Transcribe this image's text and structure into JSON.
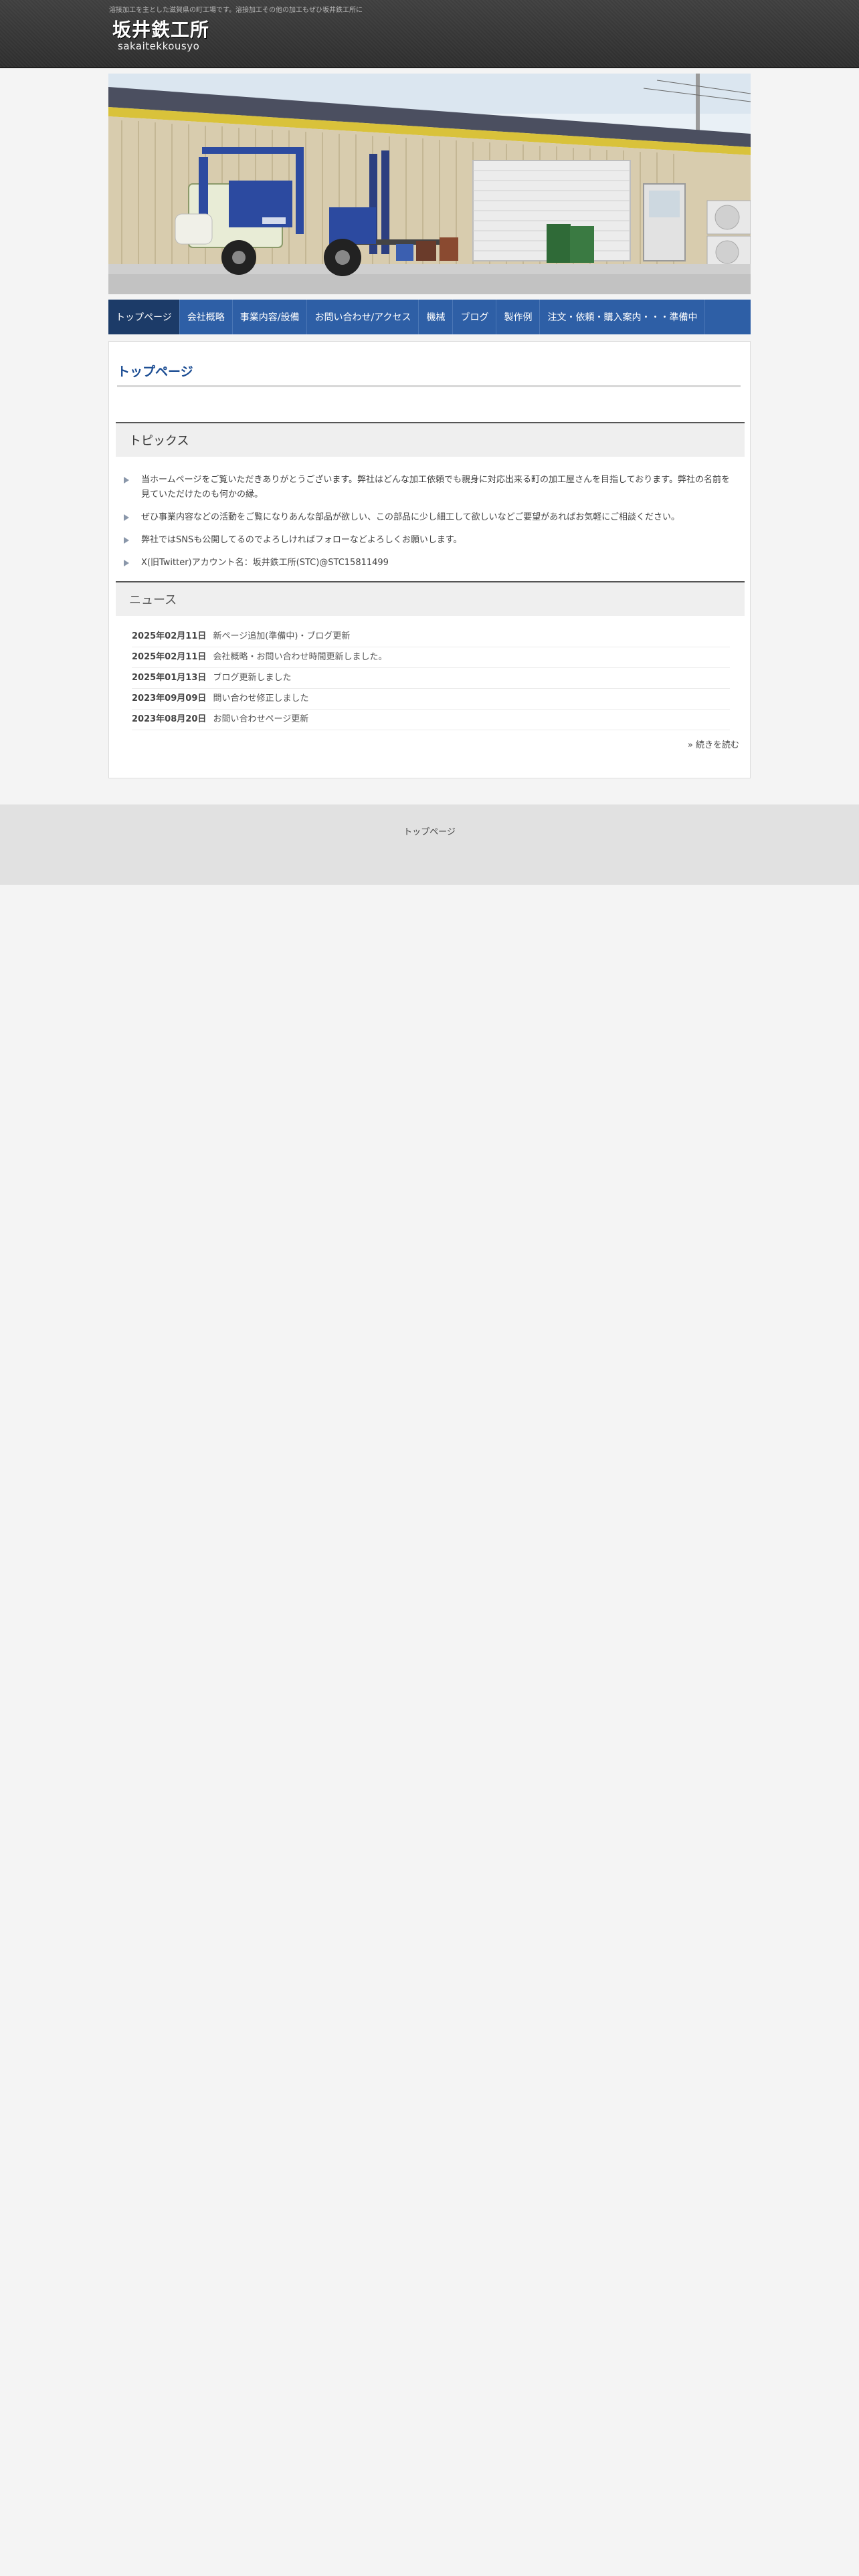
{
  "header": {
    "tagline": "溶接加工を主とした滋賀県の町工場です。溶接加工その他の加工もぜひ坂井鉄工所に",
    "logo_main": "坂井鉄工所",
    "logo_sub": "sakaitekkousyo"
  },
  "hero": {
    "alt": "forklift-in-front-of-workshop-photo"
  },
  "nav": {
    "items": [
      {
        "label": "トップページ"
      },
      {
        "label": "会社概略"
      },
      {
        "label": "事業内容/設備"
      },
      {
        "label": "お問い合わせ/アクセス"
      },
      {
        "label": "機械"
      },
      {
        "label": "ブログ"
      },
      {
        "label": "製作例"
      },
      {
        "label": "注文・依頼・購入案内・・・準備中"
      }
    ]
  },
  "main": {
    "title": "トップページ",
    "topics_heading": "トピックス",
    "topics": [
      "当ホームページをご覧いただきありがとうございます。弊社はどんな加工依頼でも親身に対応出来る町の加工屋さんを目指しております。弊社の名前を見ていただけたのも何かの縁。",
      "ぜひ事業内容などの活動をご覧になりあんな部品が欲しい、この部品に少し細工して欲しいなどご要望があればお気軽にご相談ください。",
      "弊社ではSNSも公開してるのでよろしければフォローなどよろしくお願いします。",
      "X(旧Twitter)アカウント名：坂井鉄工所(STC)@STC15811499"
    ],
    "news_heading": "ニュース",
    "news": [
      {
        "date": "2025年02月11日",
        "text": "新ページ追加(準備中)・ブログ更新"
      },
      {
        "date": "2025年02月11日",
        "text": "会社概略・お問い合わせ時間更新しました。"
      },
      {
        "date": "2025年01月13日",
        "text": "ブログ更新しました"
      },
      {
        "date": "2023年09月09日",
        "text": "問い合わせ修正しました"
      },
      {
        "date": "2023年08月20日",
        "text": "お問い合わせページ更新"
      }
    ],
    "more_label": "» 続きを読む"
  },
  "footer": {
    "link_label": "トップページ"
  }
}
